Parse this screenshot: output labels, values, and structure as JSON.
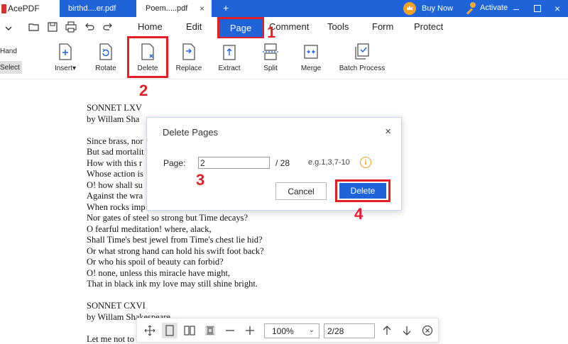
{
  "app": {
    "name": "AcePDF"
  },
  "tabs": [
    {
      "label": "birthd....er.pdf"
    },
    {
      "label": "Poem.....pdf",
      "close": "×"
    }
  ],
  "titlebar": {
    "add_tab": "+",
    "buy_now": "Buy Now",
    "activate": "Activate",
    "minimize": "–",
    "close": "×"
  },
  "menu": {
    "items": [
      "Home",
      "Edit",
      "Page",
      "Comment",
      "Tools",
      "Form",
      "Protect"
    ],
    "active": "Page"
  },
  "sidebar": {
    "hand": "Hand",
    "select": "Select"
  },
  "ribbon": {
    "tools": [
      {
        "label": "Insert",
        "icon": "insert-page-icon",
        "has_dropdown": true
      },
      {
        "label": "Rotate",
        "icon": "rotate-page-icon"
      },
      {
        "label": "Delete",
        "icon": "delete-page-icon"
      },
      {
        "label": "Replace",
        "icon": "replace-page-icon"
      },
      {
        "label": "Extract",
        "icon": "extract-page-icon"
      },
      {
        "label": "Split",
        "icon": "split-page-icon"
      },
      {
        "label": "Merge",
        "icon": "merge-page-icon"
      },
      {
        "label": "Batch Process",
        "icon": "batch-process-icon"
      }
    ]
  },
  "document": {
    "lines": [
      "SONNET LXV",
      "  by Willam Sha",
      "",
      "Since brass, nor",
      "But sad mortalit",
      "How with this r",
      "Whose action is",
      "O! how shall su",
      "Against the wra",
      "When rocks imp",
      "Nor gates of steel so strong but Time decays?",
      "O fearful meditation! where, alack,",
      "Shall Time's best jewel from Time's chest lie hid?",
      "Or what strong hand can hold his swift foot back?",
      "Or who his spoil of beauty can forbid?",
      "O! none, unless this miracle have might,",
      "That in black ink my love may still shine bright.",
      "",
      "SONNET CXVI",
      "  by Willam Shakespeare",
      "",
      "Let me not to"
    ]
  },
  "dialog": {
    "title": "Delete Pages",
    "page_label": "Page:",
    "page_value": "2",
    "total": "/ 28",
    "example": "e.g.1,3,7-10",
    "info": "i",
    "cancel": "Cancel",
    "delete": "Delete",
    "close": "×"
  },
  "annotations": [
    "1",
    "2",
    "3",
    "4"
  ],
  "annotation_color": "#e41e26",
  "accent_color": "#1f63d9",
  "bottombar": {
    "zoom": "100%",
    "page": "2/28"
  }
}
